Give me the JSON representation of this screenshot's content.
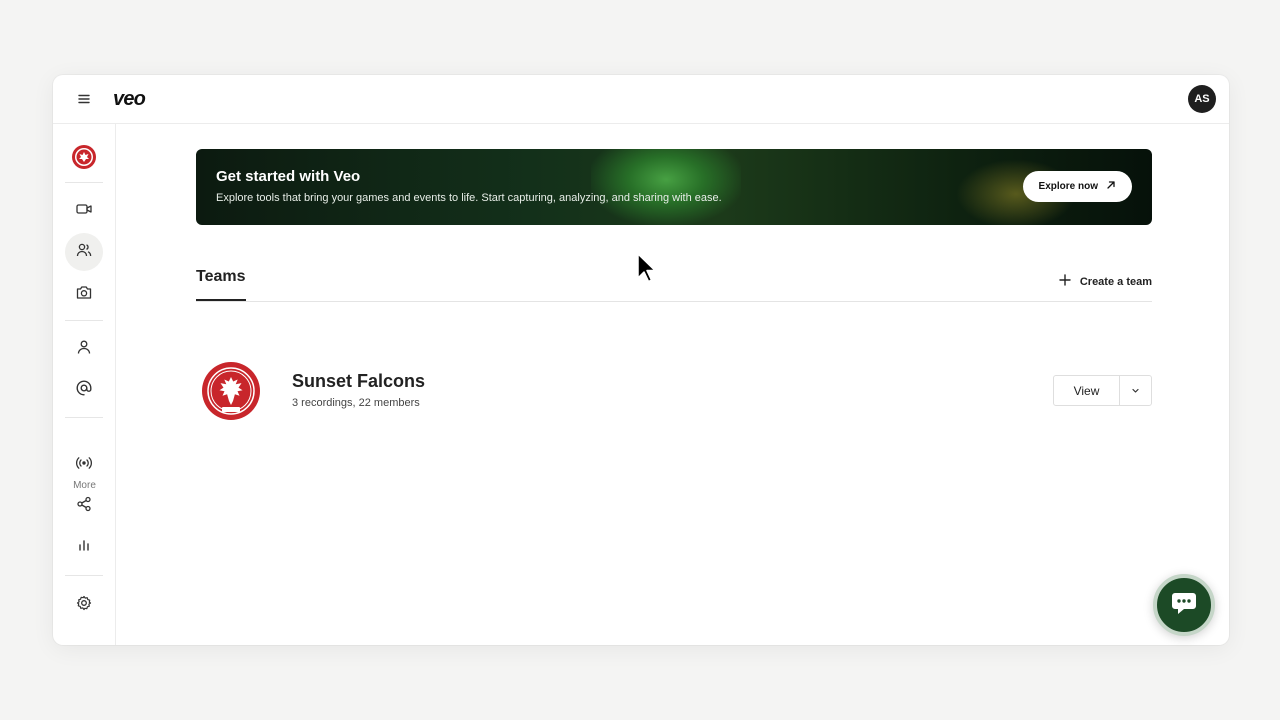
{
  "header": {
    "brand": "veo",
    "avatar_initials": "AS"
  },
  "sidebar": {
    "more_label": "More",
    "items": [
      {
        "icon": "club-crest-icon"
      },
      {
        "icon": "video-camera-icon"
      },
      {
        "icon": "users-icon",
        "active": true
      },
      {
        "icon": "camera-icon"
      },
      {
        "icon": "user-icon"
      },
      {
        "icon": "at-sign-icon"
      },
      {
        "icon": "broadcast-icon"
      },
      {
        "icon": "share-icon"
      },
      {
        "icon": "bar-chart-icon"
      },
      {
        "icon": "settings-icon"
      }
    ]
  },
  "banner": {
    "title": "Get started with Veo",
    "subtitle": "Explore tools that bring your games and events to life. Start capturing, analyzing, and sharing with ease.",
    "button_label": "Explore now"
  },
  "tabs": {
    "active": "Teams",
    "create_label": "Create a team"
  },
  "teams": [
    {
      "name": "Sunset Falcons",
      "meta": "3 recordings, 22 members",
      "view_label": "View",
      "crest_color": "#c8262b"
    }
  ],
  "colors": {
    "accent_dark_green": "#1c4a26",
    "crest_red": "#c8262b"
  }
}
